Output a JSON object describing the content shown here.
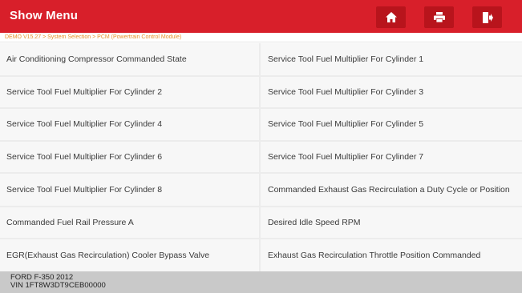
{
  "header": {
    "title": "Show Menu",
    "buttons": [
      {
        "name": "home-button",
        "icon": "home-icon"
      },
      {
        "name": "print-button",
        "icon": "printer-icon"
      },
      {
        "name": "exit-button",
        "icon": "exit-icon"
      }
    ]
  },
  "breadcrumb": "DEMO V15.27 > System Selection > PCM (Powertrain Control Module)",
  "items": [
    [
      "Air Conditioning Compressor Commanded State",
      "Service Tool Fuel Multiplier For Cylinder 1"
    ],
    [
      "Service Tool Fuel Multiplier For Cylinder 2",
      "Service Tool Fuel Multiplier For Cylinder 3"
    ],
    [
      "Service Tool Fuel Multiplier For Cylinder 4",
      "Service Tool Fuel Multiplier For Cylinder 5"
    ],
    [
      "Service Tool Fuel Multiplier For Cylinder 6",
      "Service Tool Fuel Multiplier For Cylinder 7"
    ],
    [
      "Service Tool Fuel Multiplier For Cylinder 8",
      "Commanded Exhaust Gas Recirculation a Duty Cycle or Position"
    ],
    [
      "Commanded Fuel Rail Pressure A",
      "Desired Idle Speed RPM"
    ],
    [
      "EGR(Exhaust Gas Recirculation) Cooler Bypass Valve",
      "Exhaust Gas Recirculation Throttle Position Commanded"
    ]
  ],
  "footer": {
    "vehicle": "FORD F-350 2012",
    "vin": "VIN 1FT8W3DT9CEB00000"
  },
  "colors": {
    "header_bg": "#d81f2a",
    "header_button_bg": "#b8141c",
    "breadcrumb_text": "#e8912c",
    "cell_bg": "#f7f7f7",
    "footer_bg": "#c9c9c9"
  }
}
